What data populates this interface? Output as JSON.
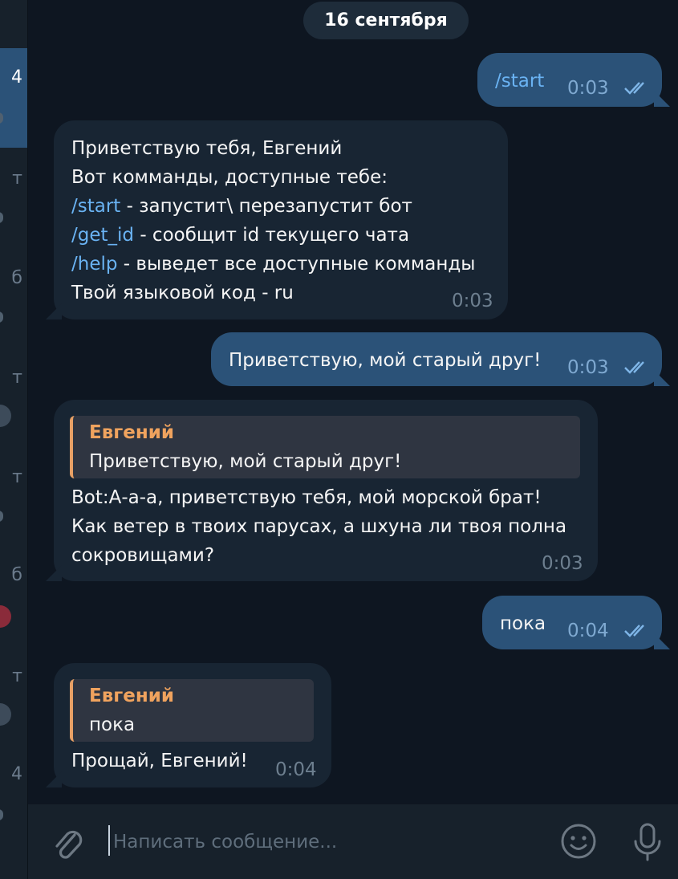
{
  "sidebar": {
    "fragments": [
      "4",
      "т",
      "б",
      "т",
      "т",
      "б",
      "т",
      "4"
    ]
  },
  "chat": {
    "date": "16 сентября",
    "messages": [
      {
        "direction": "out",
        "text": "/start",
        "time": "0:03",
        "status": "read"
      },
      {
        "direction": "in",
        "lines": [
          {
            "text": "Приветствую тебя, Евгений"
          },
          {
            "text": "Вот комманды, доступные тебе:"
          },
          {
            "cmd": "/start",
            "text": " - запустит\\ перезапустит бот"
          },
          {
            "cmd": "/get_id",
            "text": " - сообщит id текущего чата"
          },
          {
            "cmd": "/help",
            "text": " - выведет все доступные комманды"
          },
          {
            "text": "Твой языковой код - ru"
          }
        ],
        "time": "0:03"
      },
      {
        "direction": "out",
        "text": "Приветствую, мой старый друг!",
        "time": "0:03",
        "status": "read"
      },
      {
        "direction": "in",
        "reply": {
          "name": "Евгений",
          "text": "Приветствую, мой старый друг!"
        },
        "lines": [
          {
            "text": "Bot:А-а-а, приветствую тебя, мой морской брат!"
          },
          {
            "text": "Как ветер в твоих парусах, а шхуна ли твоя полна"
          },
          {
            "text": "сокровищами?"
          }
        ],
        "time": "0:03"
      },
      {
        "direction": "out",
        "text": "пока",
        "time": "0:04",
        "status": "read"
      },
      {
        "direction": "in",
        "reply": {
          "name": "Евгений",
          "text": "пока"
        },
        "lines": [
          {
            "text": "Прощай, Евгений!"
          }
        ],
        "time": "0:04"
      }
    ]
  },
  "composer": {
    "placeholder": "Написать сообщение...",
    "attach_icon": "paperclip-icon",
    "emoji_icon": "smile-icon",
    "mic_icon": "microphone-icon"
  },
  "colors": {
    "background": "#0e1621",
    "outgoing_bubble": "#2b5278",
    "incoming_bubble": "#182533",
    "command_link": "#6ab3f3",
    "reply_accent": "#e8a065"
  }
}
